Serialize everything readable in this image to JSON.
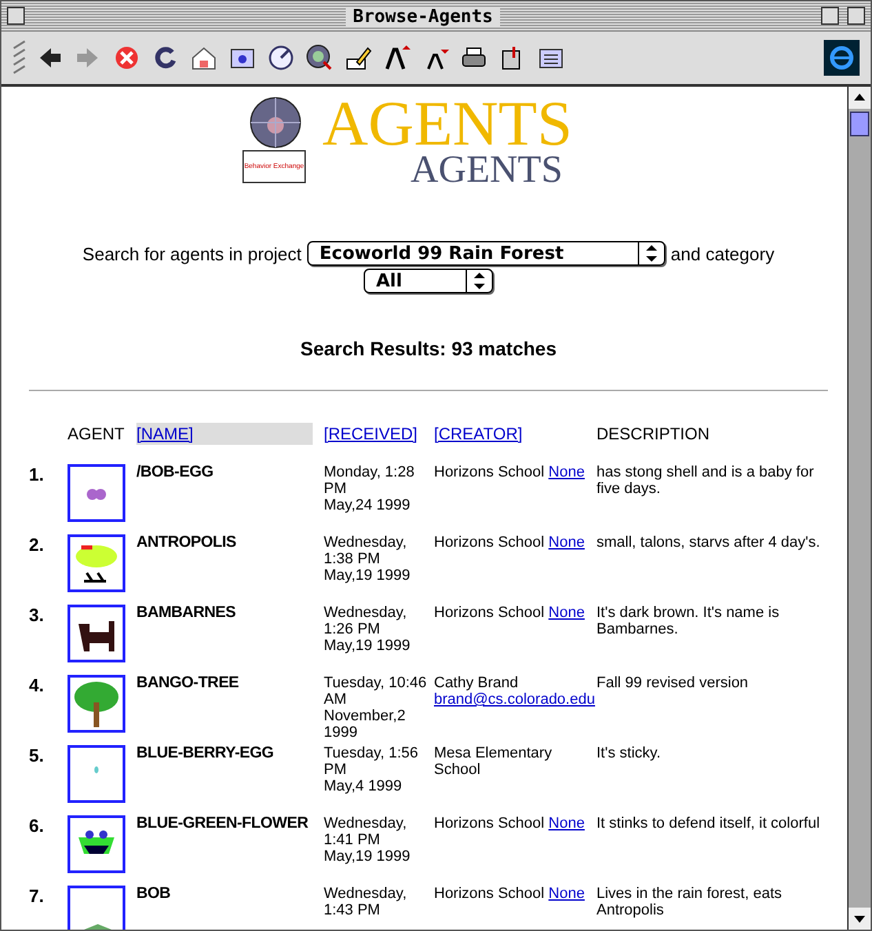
{
  "window": {
    "title": "Browse-Agents"
  },
  "logo": {
    "title": "AGENTS",
    "shadow_title": "AGENTS",
    "badge_text": "Behavior Exchange"
  },
  "search": {
    "prefix": "Search for agents in project",
    "project": "Ecoworld 99 Rain Forest",
    "middle": "and category",
    "category": "All"
  },
  "results": "Search Results: 93 matches",
  "columns": [
    {
      "label": "AGENT",
      "kind": "plain"
    },
    {
      "label": "[NAME]",
      "kind": "link",
      "selected": true
    },
    {
      "label": "[RECEIVED]",
      "kind": "link",
      "selected": false
    },
    {
      "label": "[CREATOR]",
      "kind": "link",
      "selected": false
    },
    {
      "label": "DESCRIPTION",
      "kind": "plain"
    }
  ],
  "rows": [
    {
      "number": "1.",
      "kind": "egg",
      "name": "/BOB-EGG",
      "received": [
        "Monday, 1:28",
        "PM",
        "May,24 1999"
      ],
      "creator": "Horizons School",
      "link": "None",
      "description": "has stong shell and is a baby for five days."
    },
    {
      "number": "2.",
      "kind": "bird",
      "name": "ANTROPOLIS",
      "received": [
        "Wednesday,",
        "1:38 PM",
        "May,19 1999"
      ],
      "creator": "Horizons School",
      "link": "None",
      "description": "small, talons, starvs after 4 day's."
    },
    {
      "number": "3.",
      "kind": "dog",
      "name": "BAMBARNES",
      "received": [
        "Wednesday,",
        "1:26 PM",
        "May,19 1999"
      ],
      "creator": "Horizons School",
      "link": "None",
      "description": "It's dark brown. It's name is Bambarnes."
    },
    {
      "number": "4.",
      "kind": "tree",
      "name": "BANGO-TREE",
      "received": [
        "Tuesday, 10:46",
        "AM",
        "November,2",
        "1999"
      ],
      "creator": "Cathy Brand",
      "link": "brand@cs.colorado.edu",
      "description": "Fall 99 revised version"
    },
    {
      "number": "5.",
      "kind": "dot",
      "name": "BLUE-BERRY-EGG",
      "received": [
        "Tuesday, 1:56",
        "PM",
        "May,4 1999"
      ],
      "creator": "Mesa Elementary School",
      "description": "It's sticky."
    },
    {
      "number": "6.",
      "kind": "flower",
      "name": "BLUE-GREEN-FLOWER",
      "received": [
        "Wednesday,",
        "1:41 PM",
        "May,19 1999"
      ],
      "creator": "Horizons School",
      "link": "None",
      "description": "It stinks to defend itself, it colorful"
    },
    {
      "number": "7.",
      "kind": "creature",
      "name": "BOB",
      "received": [
        "Wednesday,",
        "1:43 PM"
      ],
      "creator": "Horizons School",
      "link": "None",
      "description": "Lives in the rain forest, eats Antropolis"
    }
  ]
}
